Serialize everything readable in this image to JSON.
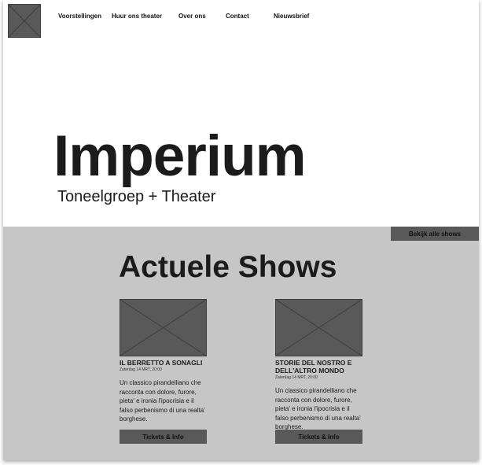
{
  "header": {
    "logo_icon": "image-placeholder-icon",
    "nav": [
      {
        "label": "Voorstellingen"
      },
      {
        "label": "Huur ons theater"
      },
      {
        "label": "Over ons"
      },
      {
        "label": "Contact"
      },
      {
        "label": "Nieuwsbrief"
      }
    ]
  },
  "hero": {
    "title": "Imperium",
    "subtitle": "Toneelgroep + Theater"
  },
  "shows": {
    "all_shows_label": "Bekijk alle shows",
    "title": "Actuele Shows",
    "cards": [
      {
        "title": "IL BERRETTO A SONAGLI",
        "date": "Zaterdag 14 MRT, 20:00",
        "description": "Un classico pirandelliano che racconta con dolore, furore, pieta' e ironia l'ipocrisia e il falso perbenismo di una realta' borghese.",
        "button_label": "Tickets & Info"
      },
      {
        "title": "STORIE DEL NOSTRO E DELL'ALTRO MONDO",
        "date": "Zaterdag 14 MRT, 20:00",
        "description": "Un classico pirandelliano che racconta con dolore, furore, pieta' e ironia l'ipocrisia e il falso perbenismo di una realta' borghese.",
        "button_label": "Tickets & Info"
      }
    ]
  },
  "colors": {
    "placeholder": "#595959",
    "section_bg": "#c6c6c6",
    "text": "#1b1b1b"
  }
}
